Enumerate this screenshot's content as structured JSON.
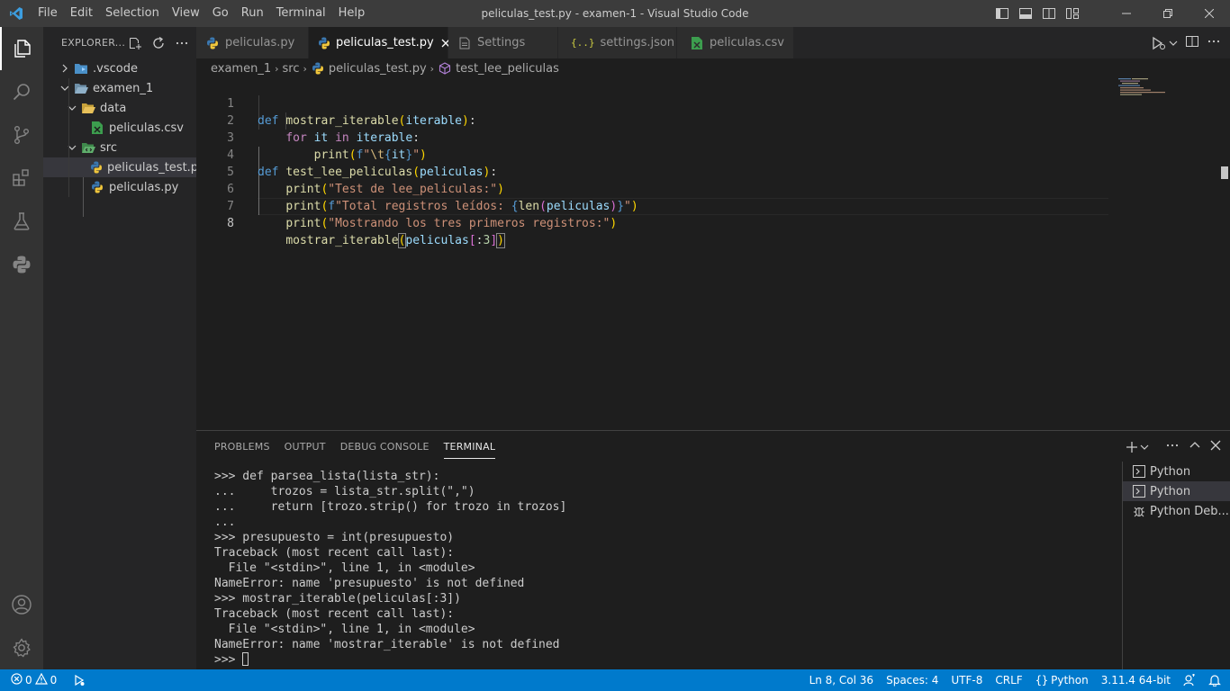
{
  "window": {
    "title": "peliculas_test.py - examen-1 - Visual Studio Code",
    "menu": [
      "File",
      "Edit",
      "Selection",
      "View",
      "Go",
      "Run",
      "Terminal",
      "Help"
    ]
  },
  "activity_bar": {
    "items": [
      "explorer-icon",
      "search-icon",
      "source-control-icon",
      "extensions-icon",
      "testing-icon",
      "python-icon"
    ],
    "bottom": [
      "account-icon",
      "manage-gear-icon"
    ]
  },
  "sidebar": {
    "title": "EXPLORER...",
    "tree": [
      {
        "label": ".vscode",
        "type": "folder",
        "expanded": false
      },
      {
        "label": "examen_1",
        "type": "folder",
        "expanded": true
      },
      {
        "label": "data",
        "type": "folder",
        "expanded": true
      },
      {
        "label": "peliculas.csv",
        "type": "csv"
      },
      {
        "label": "src",
        "type": "folder",
        "expanded": true
      },
      {
        "label": "peliculas_test.py",
        "type": "python",
        "selected": true
      },
      {
        "label": "peliculas.py",
        "type": "python"
      }
    ]
  },
  "tabs": [
    {
      "label": "peliculas.py",
      "icon": "python-file-icon"
    },
    {
      "label": "peliculas_test.py",
      "icon": "python-file-icon",
      "active": true
    },
    {
      "label": "Settings",
      "icon": "settings-file-icon"
    },
    {
      "label": "settings.json",
      "icon": "json-file-icon"
    },
    {
      "label": "peliculas.csv",
      "icon": "csv-file-icon"
    }
  ],
  "breadcrumb": [
    "examen_1",
    "src",
    "peliculas_test.py",
    "test_lee_peliculas"
  ],
  "editor": {
    "line_numbers": [
      "1",
      "2",
      "3",
      "4",
      "5",
      "6",
      "7",
      "8"
    ]
  },
  "panel": {
    "tabs": [
      "PROBLEMS",
      "OUTPUT",
      "DEBUG CONSOLE",
      "TERMINAL"
    ],
    "terminal_lines": [
      ">>> def parsea_lista(lista_str):",
      "...     trozos = lista_str.split(\",\")",
      "...     return [trozo.strip() for trozo in trozos]",
      "...",
      ">>> presupuesto = int(presupuesto)",
      "Traceback (most recent call last):",
      "  File \"<stdin>\", line 1, in <module>",
      "NameError: name 'presupuesto' is not defined",
      ">>> mostrar_iterable(peliculas[:3])",
      "Traceback (most recent call last):",
      "  File \"<stdin>\", line 1, in <module>",
      "NameError: name 'mostrar_iterable' is not defined"
    ],
    "prompt": ">>> ",
    "terminals": [
      "Python",
      "Python",
      "Python Deb..."
    ]
  },
  "status_bar": {
    "errors": "0",
    "warnings": "0",
    "position": "Ln 8, Col 36",
    "spaces": "Spaces: 4",
    "encoding": "UTF-8",
    "eol": "CRLF",
    "language": "Python",
    "interpreter": "3.11.4 64-bit"
  },
  "colors": {
    "accent": "#007acc",
    "keyword": "#569cd6",
    "control": "#c586c0",
    "function": "#dcdcaa",
    "string": "#ce9178"
  }
}
